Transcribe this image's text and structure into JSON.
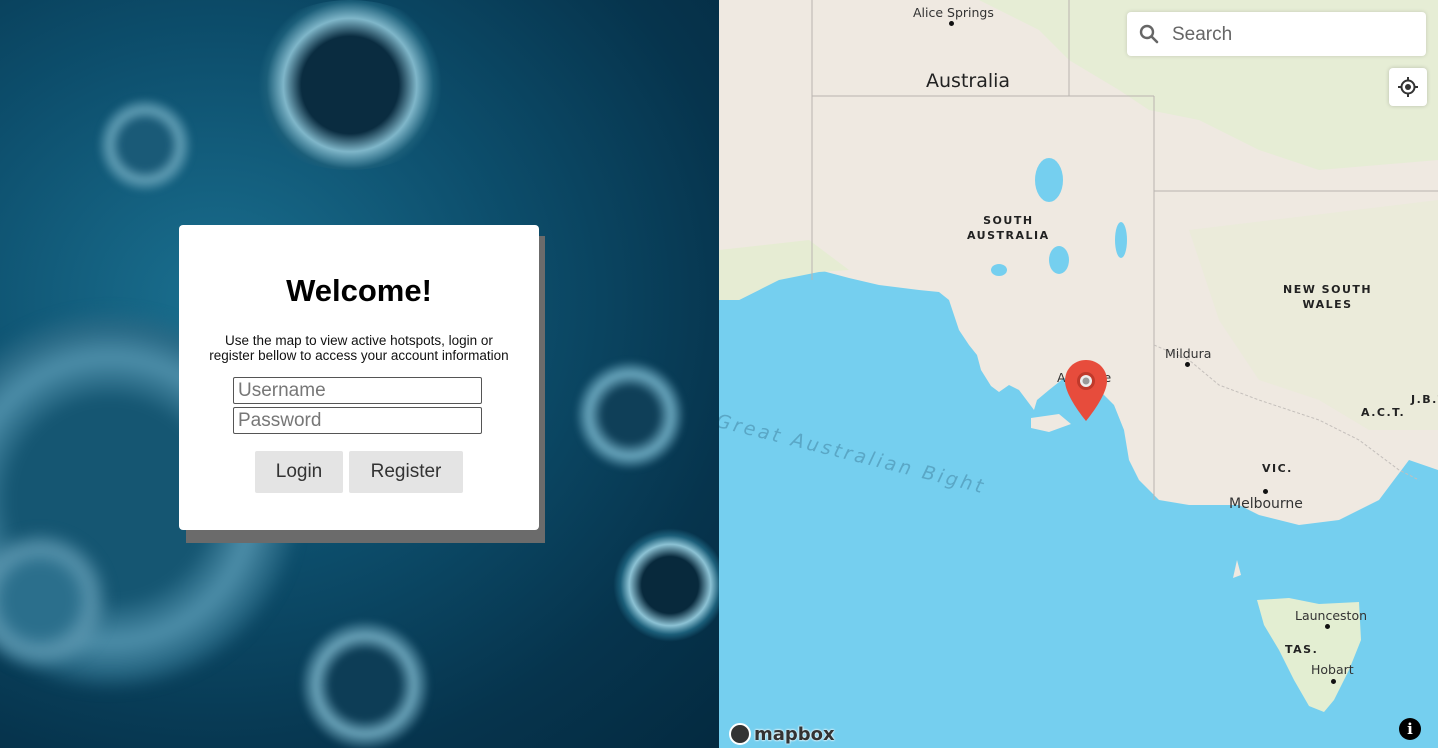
{
  "login": {
    "title": "Welcome!",
    "description": "Use the map to view active hotspots, login or register bellow to access your account information",
    "username_placeholder": "Username",
    "password_placeholder": "Password",
    "login_label": "Login",
    "register_label": "Register"
  },
  "map": {
    "search_placeholder": "Search",
    "attribution_logo": "mapbox",
    "info_label": "i",
    "labels": {
      "alice_springs": "Alice Springs",
      "australia": "Australia",
      "south_australia_1": "SOUTH",
      "south_australia_2": "AUSTRALIA",
      "nsw_1": "NEW SOUTH",
      "nsw_2": "WALES",
      "mildura": "Mildura",
      "adelaide": "Adelaide",
      "act": "A.C.T.",
      "jbt": "J.B.T.",
      "bight": "Great Australian Bight",
      "vic": "VIC.",
      "melbourne": "Melbourne",
      "launceston": "Launceston",
      "tas": "TAS.",
      "hobart": "Hobart"
    },
    "colors": {
      "water": "#75cfef",
      "land": "#efe9e1",
      "park": "#e3eed2",
      "pin": "#e74c3c"
    }
  }
}
